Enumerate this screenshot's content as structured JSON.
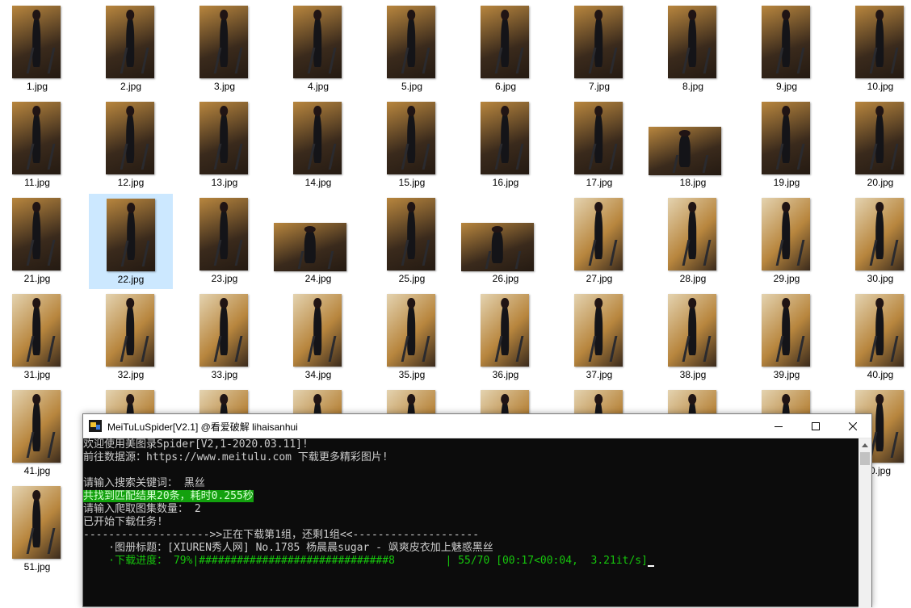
{
  "explorer": {
    "selected_index": 21,
    "files": [
      "1.jpg",
      "2.jpg",
      "3.jpg",
      "4.jpg",
      "5.jpg",
      "6.jpg",
      "7.jpg",
      "8.jpg",
      "9.jpg",
      "10.jpg",
      "11.jpg",
      "12.jpg",
      "13.jpg",
      "14.jpg",
      "15.jpg",
      "16.jpg",
      "17.jpg",
      "18.jpg",
      "19.jpg",
      "20.jpg",
      "21.jpg",
      "22.jpg",
      "23.jpg",
      "24.jpg",
      "25.jpg",
      "26.jpg",
      "27.jpg",
      "28.jpg",
      "29.jpg",
      "30.jpg",
      "31.jpg",
      "32.jpg",
      "33.jpg",
      "34.jpg",
      "35.jpg",
      "36.jpg",
      "37.jpg",
      "38.jpg",
      "39.jpg",
      "40.jpg",
      "41.jpg",
      "",
      "",
      "",
      "",
      "",
      "",
      "",
      "",
      "0.jpg",
      "51.jpg"
    ],
    "colors": {
      "selection": "#cce8ff",
      "thumb_warm": "#b8863e",
      "thumb_dark": "#3a2a1c",
      "thumb_light": "#e4d3b0"
    }
  },
  "console": {
    "title": "MeiTuLuSpider[V2.1] @看爱破解 lihaisanhui",
    "icons": {
      "app": "app-icon",
      "minimize": "minimize-icon",
      "maximize": "maximize-icon",
      "close": "close-icon",
      "scroll_up": "chevron-up-icon"
    },
    "lines": [
      "欢迎使用美图录Spider[V2,1-2020.03.11]!",
      "前往数据源：https://www.meitulu.com 下载更多精彩图片!",
      "",
      "请输入搜索关键词： 黑丝",
      "共找到匹配结果20条，耗时0.255秒",
      "请输入爬取图集数量： 2",
      "已开始下载任务!",
      "-------------------->>正在下载第1组，还剩1组<<--------------------",
      "    ·图册标题：[XIUREN秀人网] No.1785 杨晨晨sugar - 飒爽皮衣加上魅惑黑丝",
      "    ·下载进度： 79%|##############################8        | 55/70 [00:17<00:04,  3.21it/s]"
    ],
    "colors": {
      "background": "#0c0c0c",
      "text": "#cccccc",
      "highlight": "#13a10e",
      "progress": "#16c60c"
    }
  }
}
